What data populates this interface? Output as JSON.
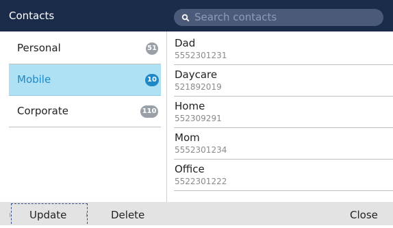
{
  "header": {
    "title": "Contacts",
    "search_placeholder": "Search contacts"
  },
  "categories": [
    {
      "label": "Personal",
      "count": "51",
      "selected": false
    },
    {
      "label": "Mobile",
      "count": "10",
      "selected": true
    },
    {
      "label": "Corporate",
      "count": "110",
      "selected": false
    }
  ],
  "contacts": [
    {
      "name": "Dad",
      "number": "5552301231"
    },
    {
      "name": "Daycare",
      "number": "521892019"
    },
    {
      "name": "Home",
      "number": "552309291"
    },
    {
      "name": "Mom",
      "number": "5552301234"
    },
    {
      "name": "Office",
      "number": "5522301222"
    }
  ],
  "softkeys": {
    "update": "Update",
    "delete": "Delete",
    "close": "Close"
  },
  "colors": {
    "header_bg": "#1b2b4a",
    "selected_bg": "#aee1f4",
    "accent": "#1e88c7",
    "badge_grey": "#9aa0a8",
    "softkey_bar": "#e3e3e3"
  }
}
